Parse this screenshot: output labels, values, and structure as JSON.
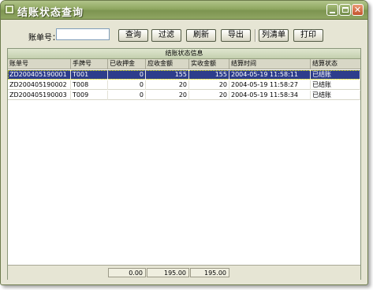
{
  "window": {
    "title": "结账状态查询"
  },
  "search": {
    "label": "账单号：",
    "value": "",
    "placeholder": ""
  },
  "toolbar": {
    "query_label": "查询",
    "filter_label": "过滤",
    "refresh_label": "刷新",
    "export_label": "导出",
    "list_label": "列清单",
    "print_label": "打印"
  },
  "panel": {
    "title": "结账状态信息"
  },
  "table": {
    "columns": [
      "账单号",
      "手牌号",
      "已收押金",
      "应收金额",
      "实收金额",
      "结算时间",
      "结算状态"
    ],
    "rows": [
      [
        "ZD200405190001",
        "T001",
        "0",
        "155",
        "155",
        "2004-05-19 11:58:11",
        "已结账"
      ],
      [
        "ZD200405190002",
        "T008",
        "0",
        "20",
        "20",
        "2004-05-19 11:58:27",
        "已结账"
      ],
      [
        "ZD200405190003",
        "T009",
        "0",
        "20",
        "20",
        "2004-05-19 11:58:34",
        "已结账"
      ]
    ],
    "selected_row": 0
  },
  "totals": {
    "deposit": "0.00",
    "receivable": "195.00",
    "received": "195.00"
  },
  "colors": {
    "titlebar": "#8fa761",
    "selection": "#2d3d8c",
    "window_bg": "#e6e5d4"
  }
}
